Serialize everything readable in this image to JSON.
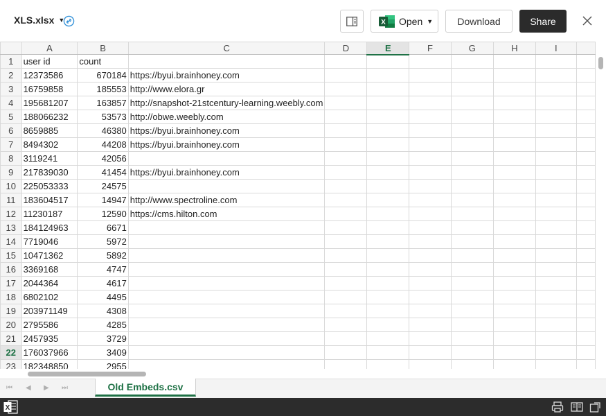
{
  "header": {
    "filename": "XLS.xlsx",
    "open_label": "Open",
    "download_label": "Download",
    "share_label": "Share"
  },
  "sheet": {
    "columns": [
      "A",
      "B",
      "C",
      "D",
      "E",
      "F",
      "G",
      "H",
      "I",
      ""
    ],
    "active_column": "E",
    "active_row": 22,
    "rows": [
      {
        "n": "1",
        "a": "user id",
        "b": "count",
        "c": ""
      },
      {
        "n": "2",
        "a": "12373586",
        "b": "670184",
        "c": "https://byui.brainhoney.com"
      },
      {
        "n": "3",
        "a": "16759858",
        "b": "185553",
        "c": "http://www.elora.gr"
      },
      {
        "n": "4",
        "a": "195681207",
        "b": "163857",
        "c": "http://snapshot-21stcentury-learning.weebly.com"
      },
      {
        "n": "5",
        "a": "188066232",
        "b": "53573",
        "c": "http://obwe.weebly.com"
      },
      {
        "n": "6",
        "a": "8659885",
        "b": "46380",
        "c": "https://byui.brainhoney.com"
      },
      {
        "n": "7",
        "a": "8494302",
        "b": "44208",
        "c": "https://byui.brainhoney.com"
      },
      {
        "n": "8",
        "a": "3119241",
        "b": "42056",
        "c": ""
      },
      {
        "n": "9",
        "a": "217839030",
        "b": "41454",
        "c": "https://byui.brainhoney.com"
      },
      {
        "n": "10",
        "a": "225053333",
        "b": "24575",
        "c": ""
      },
      {
        "n": "11",
        "a": "183604517",
        "b": "14947",
        "c": "http://www.spectroline.com"
      },
      {
        "n": "12",
        "a": "11230187",
        "b": "12590",
        "c": "https://cms.hilton.com"
      },
      {
        "n": "13",
        "a": "184124963",
        "b": "6671",
        "c": ""
      },
      {
        "n": "14",
        "a": "7719046",
        "b": "5972",
        "c": ""
      },
      {
        "n": "15",
        "a": "10471362",
        "b": "5892",
        "c": ""
      },
      {
        "n": "16",
        "a": "3369168",
        "b": "4747",
        "c": ""
      },
      {
        "n": "17",
        "a": "2044364",
        "b": "4617",
        "c": ""
      },
      {
        "n": "18",
        "a": "6802102",
        "b": "4495",
        "c": ""
      },
      {
        "n": "19",
        "a": "203971149",
        "b": "4308",
        "c": ""
      },
      {
        "n": "20",
        "a": "2795586",
        "b": "4285",
        "c": ""
      },
      {
        "n": "21",
        "a": "2457935",
        "b": "3729",
        "c": ""
      },
      {
        "n": "22",
        "a": "176037966",
        "b": "3409",
        "c": ""
      },
      {
        "n": "23",
        "a": "182348850",
        "b": "2955",
        "c": ""
      }
    ]
  },
  "tabs": {
    "sheet_tab": "Old Embeds.csv"
  },
  "colors": {
    "excel_green": "#1e7145",
    "share_bg": "#2b2b2b",
    "statusbar_bg": "#2c2c2c"
  },
  "icons": [
    "link-icon",
    "side-panel-icon",
    "excel-icon",
    "close-icon",
    "first-sheet-icon",
    "prev-sheet-icon",
    "next-sheet-icon",
    "last-sheet-icon",
    "print-icon",
    "reading-view-icon",
    "popout-icon"
  ]
}
